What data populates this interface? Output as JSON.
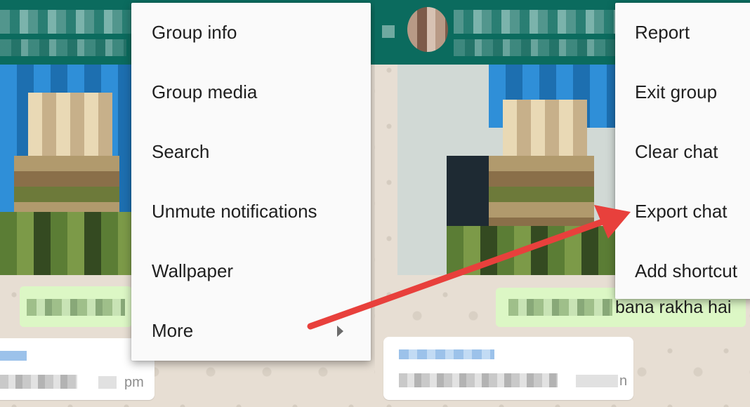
{
  "left_menu": {
    "items": [
      {
        "label": "Group info"
      },
      {
        "label": "Group media"
      },
      {
        "label": "Search"
      },
      {
        "label": "Unmute notifications"
      },
      {
        "label": "Wallpaper"
      },
      {
        "label": "More"
      }
    ]
  },
  "right_menu": {
    "items": [
      {
        "label": "Report"
      },
      {
        "label": "Exit group"
      },
      {
        "label": "Clear chat"
      },
      {
        "label": "Export chat"
      },
      {
        "label": "Add shortcut"
      }
    ]
  },
  "left_chat": {
    "time_fragment": "pm"
  },
  "right_chat": {
    "message_fragment": "bana rakha hai",
    "time_fragment": "n"
  },
  "colors": {
    "header": "#0b6b5e",
    "menu_bg": "#fafafa",
    "arrow": "#e8403c",
    "bubble_green": "#dcf7c5"
  },
  "icons": {
    "submenu_arrow": "submenu-arrow-icon",
    "annotation": "annotation-arrow"
  }
}
